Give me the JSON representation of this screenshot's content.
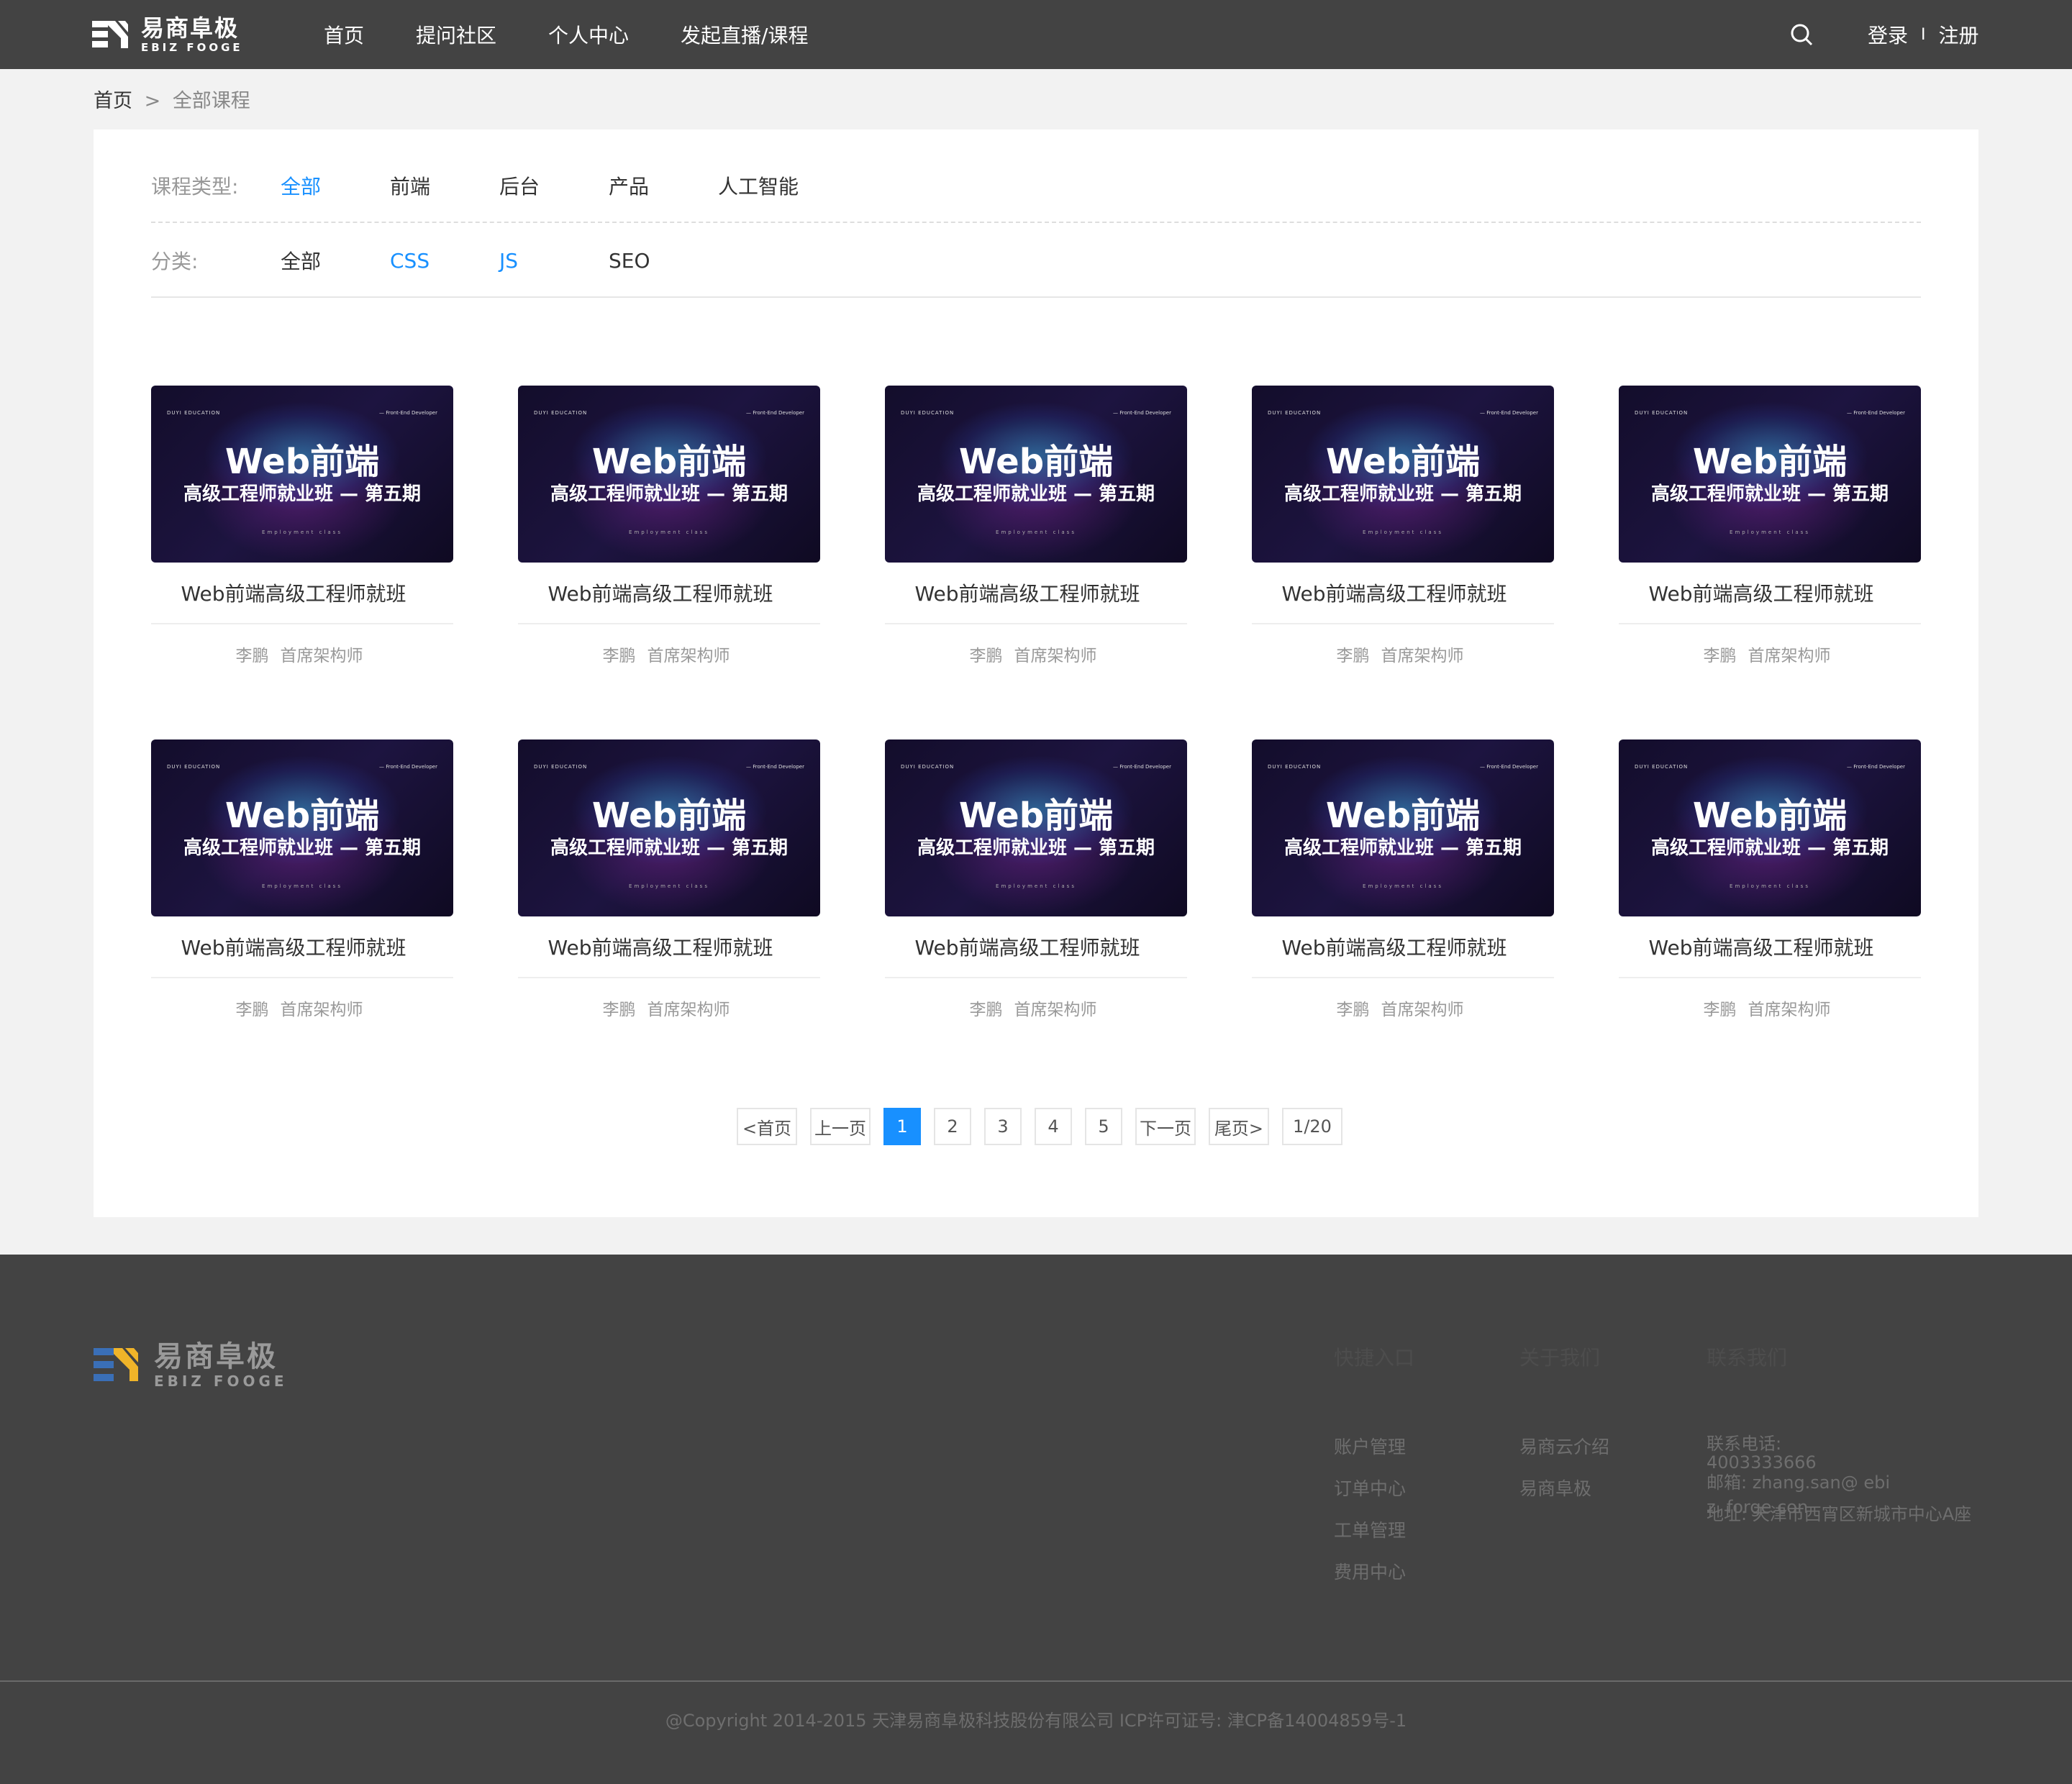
{
  "header": {
    "logo": {
      "cn": "易商阜极",
      "en": "EBIZ FOOGE"
    },
    "nav": [
      "首页",
      "提问社区",
      "个人中心",
      "发起直播/课程"
    ],
    "auth": {
      "login": "登录",
      "separator": "I",
      "register": "注册"
    }
  },
  "breadcrumb": {
    "home": "首页",
    "separator": ">",
    "current": "全部课程"
  },
  "filters": {
    "type_label": "课程类型:",
    "types": [
      "全部",
      "前端",
      "后台",
      "产品",
      "人工智能"
    ],
    "types_active": 0,
    "category_label": "分类:",
    "categories": [
      "全部",
      "CSS",
      "JS",
      "SEO"
    ],
    "categories_active": [
      1,
      2
    ]
  },
  "course_card": {
    "thumb_brand": "DUYI EDUCATION",
    "thumb_corner": "— Front-End Developer",
    "thumb_title": "Web前端",
    "thumb_subtitle": "高级工程师就业班 — 第五期",
    "thumb_caption": "Employment class",
    "title": "Web前端高级工程师就班",
    "teacher": "李鹏",
    "role": "首席架构师"
  },
  "courses": [
    {
      "title": "Web前端高级工程师就班",
      "teacher": "李鹏",
      "role": "首席架构师"
    },
    {
      "title": "Web前端高级工程师就班",
      "teacher": "李鹏",
      "role": "首席架构师"
    },
    {
      "title": "Web前端高级工程师就班",
      "teacher": "李鹏",
      "role": "首席架构师"
    },
    {
      "title": "Web前端高级工程师就班",
      "teacher": "李鹏",
      "role": "首席架构师"
    },
    {
      "title": "Web前端高级工程师就班",
      "teacher": "李鹏",
      "role": "首席架构师"
    },
    {
      "title": "Web前端高级工程师就班",
      "teacher": "李鹏",
      "role": "首席架构师"
    },
    {
      "title": "Web前端高级工程师就班",
      "teacher": "李鹏",
      "role": "首席架构师"
    },
    {
      "title": "Web前端高级工程师就班",
      "teacher": "李鹏",
      "role": "首席架构师"
    },
    {
      "title": "Web前端高级工程师就班",
      "teacher": "李鹏",
      "role": "首席架构师"
    },
    {
      "title": "Web前端高级工程师就班",
      "teacher": "李鹏",
      "role": "首席架构师"
    }
  ],
  "pagination": {
    "first": "<首页",
    "prev": "上一页",
    "pages": [
      "1",
      "2",
      "3",
      "4",
      "5"
    ],
    "active": 0,
    "next": "下一页",
    "last": "尾页>",
    "info": "1/20"
  },
  "footer": {
    "logo": {
      "cn": "易商阜极",
      "en": "EBIZ FOOGE"
    },
    "quick": {
      "head": "快捷入口",
      "items": [
        "账户管理",
        "订单中心",
        "工单管理",
        "费用中心"
      ]
    },
    "about": {
      "head": "关于我们",
      "items": [
        "易商云介绍",
        "易商阜极"
      ]
    },
    "contact": {
      "head": "联系我们",
      "phone_label": "联系电话:",
      "phone": "4003333666",
      "email": "邮箱: zhang.san@ ebiz. forge.con",
      "address": "地址: 天津市西宵区新城市中心A座"
    },
    "copyright": "@Copyright 2014-2015 天津易商阜极科技股份有限公司 ICP许可证号: 津CP备14004859号-1"
  },
  "colors": {
    "header_bg": "#434343",
    "accent": "#1890ff",
    "footer_bg": "#434343",
    "logo_blue": "#3a6fb7",
    "logo_yellow": "#f0b429"
  }
}
